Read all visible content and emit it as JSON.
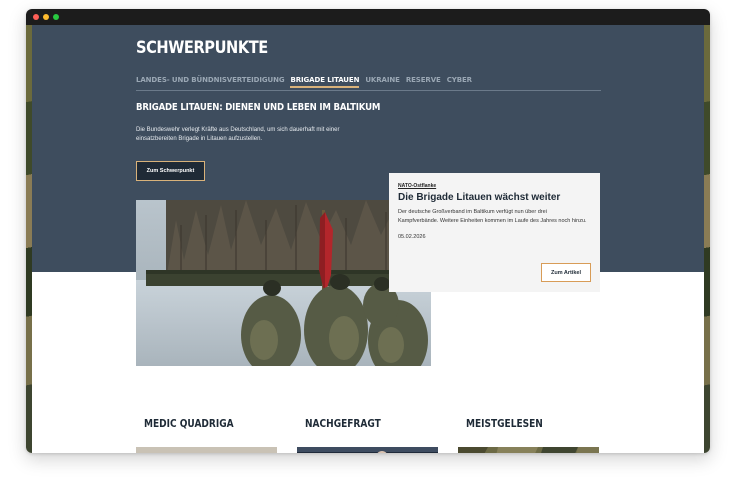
{
  "section_title": "SCHWERPUNKTE",
  "tabs": [
    {
      "label": "LANDES- UND BÜNDNISVERTEIDIGUNG",
      "active": false
    },
    {
      "label": "BRIGADE LITAUEN",
      "active": true
    },
    {
      "label": "UKRAINE",
      "active": false
    },
    {
      "label": "RESERVE",
      "active": false
    },
    {
      "label": "CYBER",
      "active": false
    }
  ],
  "hero": {
    "headline": "BRIGADE LITAUEN: DIENEN UND LEBEN IM BALTIKUM",
    "intro": "Die Bundeswehr verlegt Kräfte aus Deutschland, um sich dauerhaft mit einer einsatzbereiten Brigade in Litauen aufzustellen.",
    "cta_label": "Zum Schwerpunkt"
  },
  "card": {
    "kicker": "NATO-Ostflanke",
    "title": "Die Brigade Litauen wächst weiter",
    "text": "Der deutsche Großverband im Baltikum verfügt nun über drei Kampfverbände. Weitere Einheiten kommen im Laufe des Jahres noch hinzu.",
    "date": "05.02.2026",
    "button_label": "Zum Artikel"
  },
  "columns": [
    {
      "title": "MEDIC QUADRIGA"
    },
    {
      "title": "NACHGEFRAGT"
    },
    {
      "title": "MEISTGELESEN"
    }
  ],
  "colors": {
    "hero_bg": "#3e4d5e",
    "accent": "#d9b27a",
    "card_button_border": "#d89c57"
  }
}
